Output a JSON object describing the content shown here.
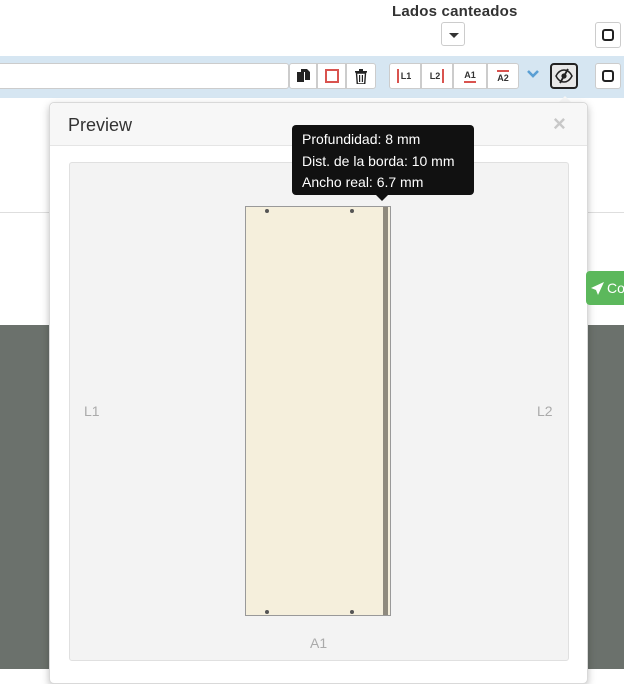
{
  "header": {
    "title": "Lados canteados"
  },
  "toolbar": {
    "edge_buttons": [
      {
        "label": "L1"
      },
      {
        "label": "L2"
      },
      {
        "label": "A1"
      },
      {
        "label": "A2"
      }
    ]
  },
  "preview": {
    "title": "Preview",
    "close": "×",
    "labels": {
      "left": "L1",
      "right": "L2",
      "bottom": "A1"
    },
    "tooltip": {
      "line1": "Profundidad: 8 mm",
      "line2": "Dist. de la borda: 10 mm",
      "line3": "Ancho real: 6.7 mm"
    }
  },
  "side_button": {
    "label": "Co"
  },
  "colors": {
    "toolbar_bg": "#d6e6f2",
    "board_fill": "#f5efdc",
    "edge_strip": "#8f8a7e",
    "accent_red": "#d9534f",
    "success_green": "#5cb85c",
    "chevron_blue": "#5a9fd4"
  }
}
